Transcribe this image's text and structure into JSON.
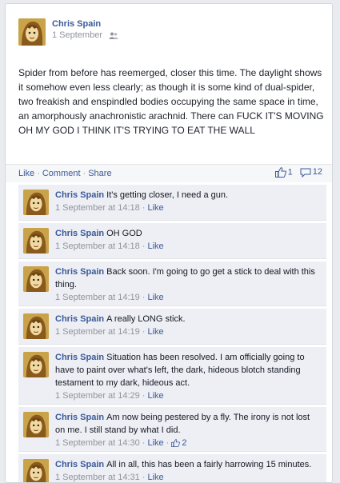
{
  "post": {
    "author": "Chris Spain",
    "date": "1 September",
    "audience_icon": "friends-icon",
    "text": "Spider from before has reemerged, closer this time. The daylight shows it somehow even less clearly; as though it is some kind of dual-spider, two freakish and enspindled bodies occupying the same space in time, an amorphously anachronistic arachnid. There can FUCK IT'S MOVING OH MY GOD I THINK IT'S TRYING TO EAT THE WALL"
  },
  "actions": {
    "like": "Like",
    "comment": "Comment",
    "share": "Share",
    "separator": "·"
  },
  "stats": {
    "likes": "1",
    "comments": "12"
  },
  "comments": [
    {
      "author": "Chris Spain",
      "text": "It's getting closer, I need a gun.",
      "time": "1 September at 14:18",
      "like_label": "Like",
      "likes": ""
    },
    {
      "author": "Chris Spain",
      "text": "OH GOD",
      "time": "1 September at 14:18",
      "like_label": "Like",
      "likes": ""
    },
    {
      "author": "Chris Spain",
      "text": "Back soon. I'm going to go get a stick to deal with this thing.",
      "time": "1 September at 14:19",
      "like_label": "Like",
      "likes": ""
    },
    {
      "author": "Chris Spain",
      "text": "A really LONG stick.",
      "time": "1 September at 14:19",
      "like_label": "Like",
      "likes": ""
    },
    {
      "author": "Chris Spain",
      "text": "Situation has been resolved. I am officially going to have to paint over what's left, the dark, hideous blotch standing testament to my dark, hideous act.",
      "time": "1 September at 14:29",
      "like_label": "Like",
      "likes": ""
    },
    {
      "author": "Chris Spain",
      "text": "Am now being pestered by a fly. The irony is not lost on me. I still stand by what I did.",
      "time": "1 September at 14:30",
      "like_label": "Like",
      "likes": "2"
    },
    {
      "author": "Chris Spain",
      "text": "All in all, this has been a fairly harrowing 15 minutes.",
      "time": "1 September at 14:31",
      "like_label": "Like",
      "likes": ""
    }
  ],
  "colors": {
    "link": "#3b5998",
    "meta": "#90949c",
    "comment_bg": "#edeff4",
    "avatar_bg": "#c9a34a"
  }
}
